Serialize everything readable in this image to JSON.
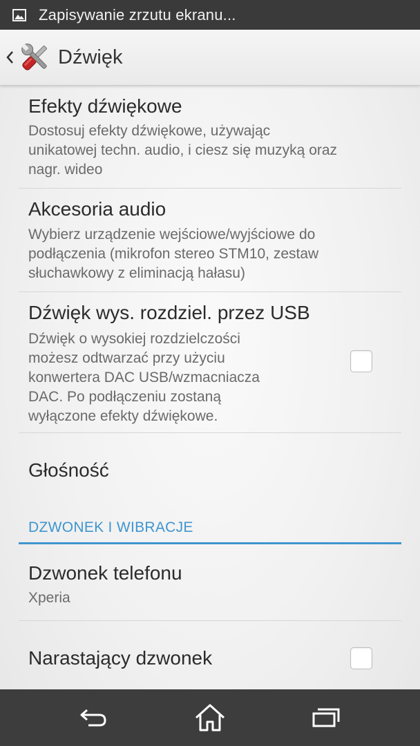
{
  "status_bar": {
    "notification_icon": "image-icon",
    "text": "Zapisywanie zrzutu ekranu..."
  },
  "action_bar": {
    "back_icon": "chevron-left-icon",
    "app_icon": "settings-tools-icon",
    "title": "Dźwięk"
  },
  "items": [
    {
      "title": "Efekty dźwiękowe",
      "summary": "Dostosuj efekty dźwiękowe, używając\nunikatowej techn. audio, i ciesz się muzyką oraz\nnagr. wideo"
    },
    {
      "title": "Akcesoria audio",
      "summary": "Wybierz urządzenie wejściowe/wyjściowe do\npodłączenia (mikrofon stereo STM10, zestaw\nsłuchawkowy z eliminacją hałasu)"
    },
    {
      "title": "Dźwięk wys. rozdziel. przez USB",
      "summary": "Dźwięk o wysokiej rozdzielczości\nmożesz odtwarzać przy użyciu\nkonwertera DAC USB/wzmacniacza\nDAC. Po podłączeniu zostaną\nwyłączone efekty dźwiękowe.",
      "checked": false
    },
    {
      "title": "Głośność"
    }
  ],
  "section": {
    "header": "DZWONEK I WIBRACJE",
    "accent_color": "#3f95cf"
  },
  "section_items": [
    {
      "title": "Dzwonek telefonu",
      "summary": "Xperia"
    },
    {
      "title": "Narastający dzwonek",
      "checked": false
    }
  ],
  "nav_bar": {
    "back_icon": "back-arrow-icon",
    "home_icon": "home-icon",
    "recents_icon": "recent-apps-icon"
  }
}
